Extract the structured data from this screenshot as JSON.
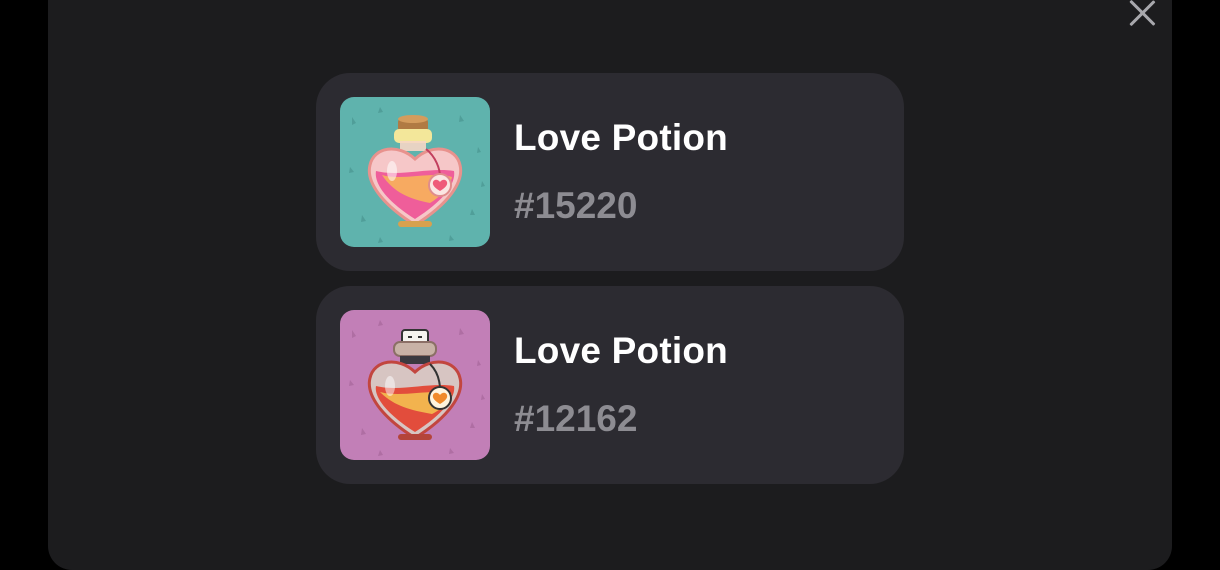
{
  "dialog": {
    "close_label": "Close",
    "items": [
      {
        "name": "Love Potion",
        "number": "#15220",
        "image_bg": "#5fb3ad",
        "image_icon": "heart-potion-icon"
      },
      {
        "name": "Love Potion",
        "number": "#12162",
        "image_bg": "#c27fb7",
        "image_icon": "heart-potion-icon"
      }
    ]
  }
}
